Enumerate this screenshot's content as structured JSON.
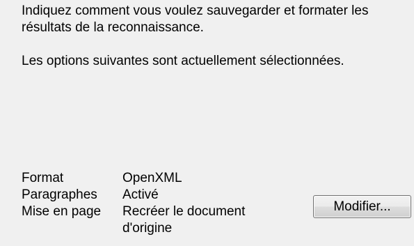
{
  "intro": {
    "line1": "Indiquez comment vous voulez sauvegarder et formater les",
    "line2": "résultats de la reconnaissance.",
    "line3": "Les options suivantes sont actuellement sélectionnées."
  },
  "settings": [
    {
      "label": "Format",
      "value": "OpenXML"
    },
    {
      "label": "Paragraphes",
      "value": "Activé"
    },
    {
      "label": "Mise en page",
      "value_line1": "Recréer le document",
      "value_line2": "d'origine"
    }
  ],
  "modify_button": {
    "label": "Modifier..."
  }
}
